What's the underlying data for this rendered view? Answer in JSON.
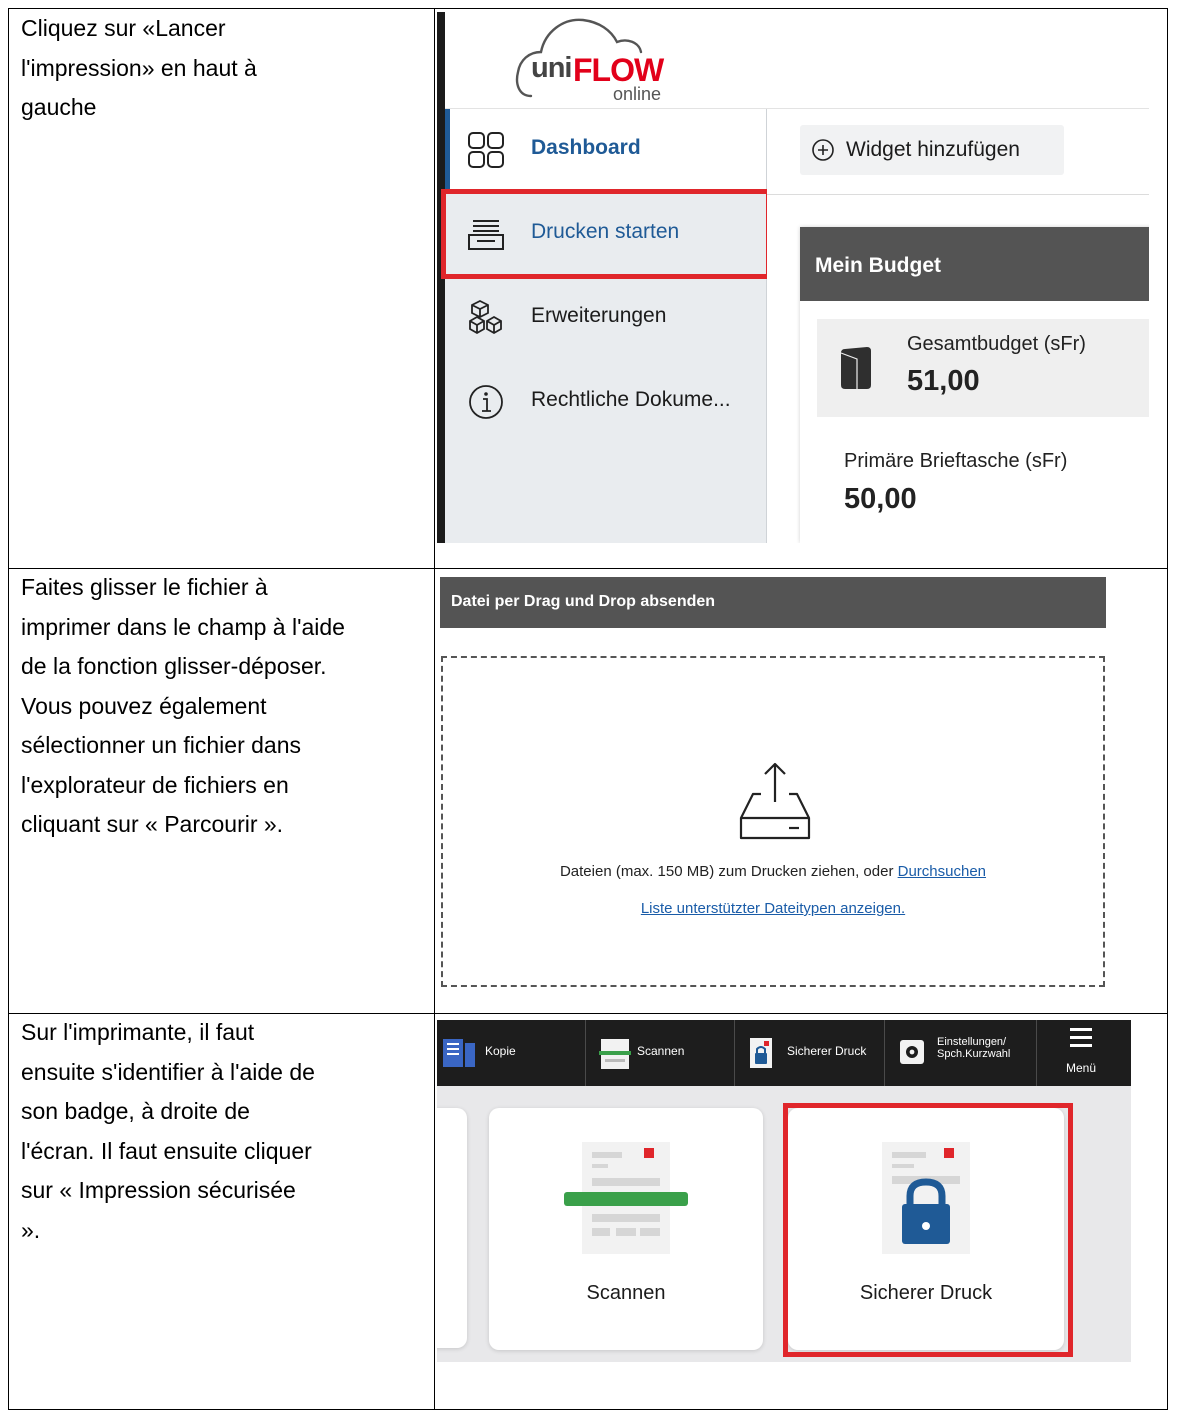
{
  "instructions": {
    "row1": [
      "Cliquez sur «Lancer",
      "l'impression» en haut à",
      "gauche"
    ],
    "row2": [
      "Faites glisser le fichier à",
      "imprimer dans le champ à l'aide",
      "de la fonction glisser-déposer.",
      "Vous pouvez également",
      "sélectionner un fichier dans",
      "l'explorateur de fichiers en",
      "cliquant sur « Parcourir »."
    ],
    "row3": [
      "Sur l'imprimante, il faut",
      "ensuite s'identifier à l'aide de",
      "son badge, à droite de",
      "l'écran. Il faut ensuite cliquer",
      "sur « Impression sécurisée",
      "»."
    ]
  },
  "uniflow": {
    "logo": {
      "uni": "uni",
      "flow": "FLOW",
      "online": "online"
    },
    "sidebar": [
      {
        "label": "Dashboard",
        "icon": "dashboard-grid-icon"
      },
      {
        "label": "Drucken starten",
        "icon": "printer-tray-icon"
      },
      {
        "label": "Erweiterungen",
        "icon": "cubes-icon"
      },
      {
        "label": "Rechtliche Dokume...",
        "icon": "info-circle-icon"
      }
    ],
    "widget_button": "Widget hinzufügen",
    "budget": {
      "title": "Mein Budget",
      "total_label": "Gesamtbudget (sFr)",
      "total_value": "51,00",
      "primary_label": "Primäre Brieftasche (sFr)",
      "primary_value": "50,00"
    },
    "highlight_color": "#e0262b",
    "accent_color": "#1f5a96"
  },
  "dragdrop": {
    "header": "Datei per Drag und Drop absenden",
    "text_before_link": "Dateien (max. 150 MB) zum Drucken ziehen, oder ",
    "browse_link": "Durchsuchen",
    "filetypes_link": "Liste unterstützter Dateitypen anzeigen."
  },
  "printer": {
    "toolbar": {
      "copy": "Kopie",
      "scan": "Scannen",
      "secure_print": "Sicherer Druck",
      "settings_line1": "Einstellungen/",
      "settings_line2": "Spch.Kurzwahl",
      "menu": "Menü"
    },
    "tiles": {
      "scan": "Scannen",
      "secure_print": "Sicherer Druck"
    }
  }
}
